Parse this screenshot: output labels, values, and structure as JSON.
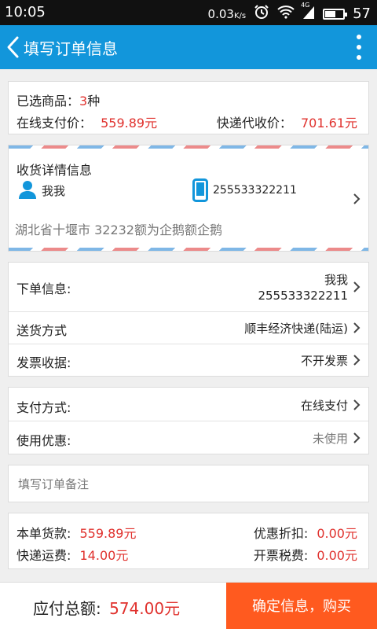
{
  "status_bar": {
    "time": "10:05",
    "speed": "0.03",
    "speed_unit": "K/s",
    "network": "4G",
    "battery": "57"
  },
  "app_bar": {
    "title": "填写订单信息"
  },
  "summary": {
    "selected_label": "已选商品：",
    "selected_count": "3",
    "selected_unit": "种",
    "online_label": "在线支付价：",
    "online_value": "559.89",
    "online_unit": "元",
    "cod_label": "快递代收价：",
    "cod_value": "701.61",
    "cod_unit": "元"
  },
  "address": {
    "title": "收货详情信息",
    "name": "我我",
    "phone": "255533322211",
    "address": "湖北省十堰市  32232额为企鹅额企鹅"
  },
  "order": {
    "orderer_label": "下单信息:",
    "orderer_name": "我我",
    "orderer_phone": "255533322211",
    "delivery_label": "送货方式",
    "delivery_value": "顺丰经济快递(陆运)",
    "invoice_label": "发票收据:",
    "invoice_value": "不开发票"
  },
  "payment": {
    "method_label": "支付方式:",
    "method_value": "在线支付",
    "coupon_label": "使用优惠:",
    "coupon_value": "未使用"
  },
  "note": {
    "placeholder": "填写订单备注"
  },
  "costs": {
    "goods_label": "本单货款:",
    "goods_value": "559.89",
    "goods_unit": "元",
    "discount_label": "优惠折扣:",
    "discount_value": "0.00",
    "discount_unit": "元",
    "shipping_label": "快递运费:",
    "shipping_value": "14.00",
    "shipping_unit": "元",
    "tax_label": "开票税费:",
    "tax_value": "0.00",
    "tax_unit": "元"
  },
  "bottom": {
    "total_label": "应付总额:",
    "total_value": "574.00",
    "total_unit": "元",
    "confirm_label": "确定信息，购买"
  },
  "colors": {
    "primary": "#1296db",
    "accent_red": "#e0312d",
    "button_orange": "#ff5a1f"
  }
}
